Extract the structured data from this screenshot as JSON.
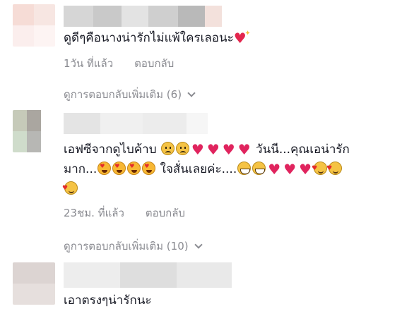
{
  "comments": [
    {
      "text": "ดูดีๆคือนางน่ารักไม่แพ้ใครเลอนะ",
      "time": "1วัน ที่แล้ว",
      "reply": "ตอบกลับ",
      "more_replies": "ดูการตอบกลับเพิ่มเติม (6)",
      "emojis": [
        "sparkling-heart"
      ]
    },
    {
      "text_line1_a": "เอฟซีจากดูไบค้าบ",
      "text_line1_b": "วันนี...คุณเอน่ารัก",
      "text_line2_a": "มาก...",
      "text_line2_b": "ใจสั่นเลยค่ะ....",
      "time": "23ชม. ที่แล้ว",
      "reply": "ตอบกลับ",
      "more_replies": "ดูการตอบกลับเพิ่มเติม (10)",
      "emojis": [
        "sad-face",
        "sad-face",
        "heart",
        "heart",
        "heart",
        "heart",
        "heart-eyes",
        "heart-eyes",
        "heart-eyes",
        "heart-eyes",
        "grin",
        "grin",
        "heart",
        "heart",
        "heart",
        "smiling-hearts",
        "smiling-hearts",
        "smiling-hearts"
      ]
    },
    {
      "text": "เอาตรงๆน่ารักนะ"
    }
  ],
  "colors": {
    "text": "#161823",
    "secondary": "#8a8b91",
    "heart": "#e0245e"
  }
}
